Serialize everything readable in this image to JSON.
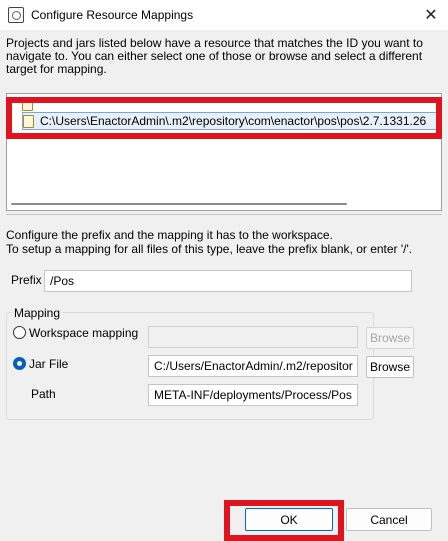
{
  "window": {
    "title": "Configure Resource Mappings",
    "close_glyph": "✕"
  },
  "description": "Projects and jars listed below have a resource that matches the ID you want to navigate to. You can either select one of those or browse and select a different target for mapping.",
  "list": {
    "items": [
      {
        "label": ""
      },
      {
        "label": "C:\\Users\\EnactorAdmin\\.m2\\repository\\com\\enactor\\pos\\pos\\2.7.1331.26"
      }
    ]
  },
  "prefix_section": {
    "line1": "Configure the prefix and the mapping it has to the workspace.",
    "line2": "To setup a mapping for all files of this type, leave the prefix blank, or enter '/'.",
    "prefix_label": "Prefix",
    "prefix_value": "/Pos"
  },
  "mapping": {
    "group_label": "Mapping",
    "workspace_label": "Workspace mapping",
    "workspace_value": "",
    "workspace_browse": "Browse",
    "jar_label": "Jar File",
    "jar_value": "C:/Users/EnactorAdmin/.m2/repositor",
    "jar_browse": "Browse",
    "path_label": "Path",
    "path_value": "META-INF/deployments/Process/Pos"
  },
  "buttons": {
    "ok": "OK",
    "cancel": "Cancel"
  },
  "colors": {
    "highlight_red": "#e0141e",
    "accent_blue": "#005fb8"
  }
}
